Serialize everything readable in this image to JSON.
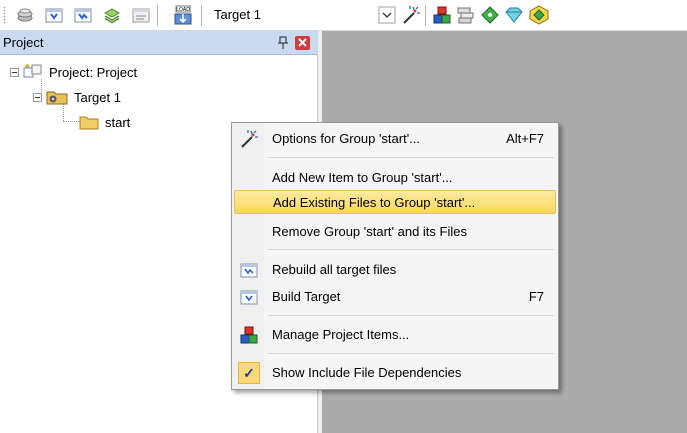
{
  "toolbar": {
    "target_combo": "Target 1",
    "icons": [
      "stack-icon",
      "translate-icon",
      "build-icon",
      "rebuild-icon",
      "batch-build-icon",
      "load-icon",
      "dropdown-arrow-icon",
      "wand-icon",
      "manage-project-icon",
      "component-icon",
      "diamond-icon",
      "shield-icon",
      "pack-icon"
    ]
  },
  "project_panel": {
    "title": "Project",
    "tree": {
      "root": "Project: Project",
      "target": "Target 1",
      "group": "start"
    }
  },
  "context_menu": {
    "items": [
      {
        "label": "Options for Group 'start'...",
        "shortcut": "Alt+F7",
        "icon": "wand-icon"
      },
      {
        "label": "Add New  Item to Group 'start'...",
        "shortcut": "",
        "icon": ""
      },
      {
        "label": "Add Existing Files to Group 'start'...",
        "shortcut": "",
        "icon": "",
        "highlighted": true
      },
      {
        "label": "Remove Group 'start' and its Files",
        "shortcut": "",
        "icon": ""
      },
      {
        "label": "Rebuild all target files",
        "shortcut": "",
        "icon": "rebuild-icon"
      },
      {
        "label": "Build Target",
        "shortcut": "F7",
        "icon": "build-icon"
      },
      {
        "label": "Manage Project Items...",
        "shortcut": "",
        "icon": "manage-project-icon"
      },
      {
        "label": "Show Include File Dependencies",
        "shortcut": "",
        "icon": "check-icon",
        "checked": true
      }
    ]
  },
  "colors": {
    "panel_title": "#c9daf0",
    "workspace": "#ababab",
    "highlight": "#f9d860"
  }
}
